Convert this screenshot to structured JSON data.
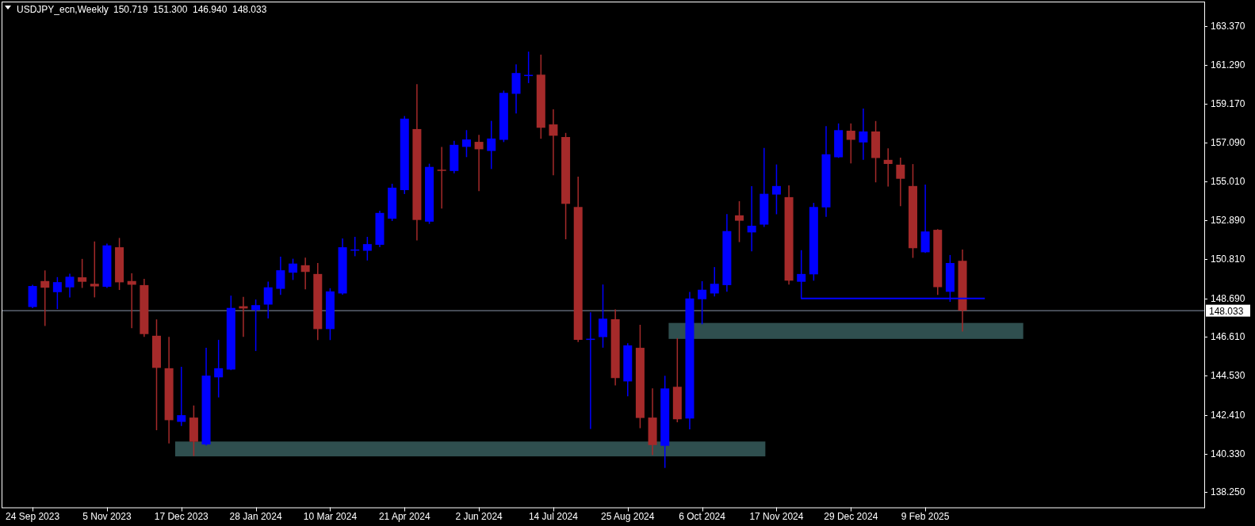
{
  "header": {
    "values": [
      "150.719",
      "151.300",
      "146.940",
      "148.033"
    ]
  },
  "chart_data": {
    "type": "candlestick",
    "title": "USDJPY_ecn,Weekly",
    "categories": [
      null,
      null,
      "24 Sep 2023",
      null,
      null,
      null,
      null,
      null,
      "5 Nov 2023",
      null,
      null,
      null,
      null,
      null,
      "17 Dec 2023",
      null,
      null,
      null,
      null,
      null,
      "28 Jan 2024",
      null,
      null,
      null,
      null,
      null,
      "10 Mar 2024",
      null,
      null,
      null,
      null,
      null,
      "21 Apr 2024",
      null,
      null,
      null,
      null,
      null,
      "2 Jun 2024",
      null,
      null,
      null,
      null,
      null,
      "14 Jul 2024",
      null,
      null,
      null,
      null,
      null,
      "25 Aug 2024",
      null,
      null,
      null,
      null,
      null,
      "6 Oct 2024",
      null,
      null,
      null,
      null,
      null,
      "17 Nov 2024",
      null,
      null,
      null,
      null,
      null,
      "29 Dec 2024",
      null,
      null,
      null,
      null,
      null,
      "9 Feb 2025",
      null,
      null,
      null,
      null,
      null,
      null,
      null,
      null,
      null,
      null,
      null,
      null,
      null,
      null,
      null,
      null,
      null,
      null,
      null,
      null,
      null,
      null
    ],
    "ohlc": [
      null,
      null,
      [
        148.23,
        149.4,
        148.2,
        149.36
      ],
      [
        149.63,
        150.17,
        147.24,
        149.27
      ],
      [
        149.03,
        149.81,
        148.15,
        149.57
      ],
      [
        149.29,
        149.99,
        148.78,
        149.86
      ],
      [
        149.83,
        150.79,
        149.29,
        149.59
      ],
      [
        149.48,
        151.73,
        148.78,
        149.34
      ],
      [
        149.32,
        151.62,
        149.29,
        151.55
      ],
      [
        151.45,
        151.92,
        149.18,
        149.56
      ],
      [
        149.63,
        150.01,
        147.12,
        149.43
      ],
      [
        149.41,
        149.72,
        146.65,
        146.77
      ],
      [
        146.68,
        147.53,
        141.62,
        144.95
      ],
      [
        144.93,
        146.59,
        140.91,
        142.13
      ],
      [
        142.04,
        144.98,
        141.85,
        142.4
      ],
      [
        142.27,
        142.89,
        140.23,
        140.97
      ],
      [
        140.82,
        146.0,
        140.79,
        144.53
      ],
      [
        144.44,
        146.43,
        143.39,
        144.93
      ],
      [
        144.86,
        148.81,
        144.86,
        148.18
      ],
      [
        148.27,
        148.74,
        146.65,
        148.15
      ],
      [
        148.06,
        148.6,
        145.89,
        148.33
      ],
      [
        148.36,
        149.57,
        147.64,
        149.29
      ],
      [
        149.21,
        150.91,
        148.91,
        150.21
      ],
      [
        150.08,
        150.8,
        149.72,
        150.57
      ],
      [
        150.48,
        150.86,
        149.21,
        150.12
      ],
      [
        150.01,
        150.57,
        146.48,
        147.04
      ],
      [
        147.04,
        149.21,
        146.48,
        149.07
      ],
      [
        148.96,
        151.89,
        148.92,
        151.45
      ],
      [
        151.31,
        151.98,
        151.0,
        151.33
      ],
      [
        151.26,
        151.98,
        150.77,
        151.62
      ],
      [
        151.58,
        153.39,
        151.49,
        153.3
      ],
      [
        152.99,
        154.84,
        152.9,
        154.66
      ],
      [
        154.53,
        158.49,
        154.35,
        158.38
      ],
      [
        157.82,
        160.21,
        151.85,
        152.92
      ],
      [
        152.83,
        155.92,
        152.74,
        155.78
      ],
      [
        155.63,
        156.82,
        153.57,
        155.6
      ],
      [
        155.56,
        157.15,
        155.47,
        156.97
      ],
      [
        156.86,
        157.73,
        156.34,
        157.26
      ],
      [
        157.13,
        157.48,
        154.51,
        156.73
      ],
      [
        156.64,
        158.23,
        155.7,
        157.31
      ],
      [
        157.24,
        159.86,
        157.15,
        159.77
      ],
      [
        159.72,
        161.27,
        158.69,
        160.84
      ],
      [
        160.72,
        161.96,
        160.33,
        160.74
      ],
      [
        160.75,
        161.8,
        157.33,
        157.89
      ],
      [
        158.07,
        158.85,
        155.36,
        157.46
      ],
      [
        157.39,
        157.58,
        151.91,
        153.79
      ],
      [
        153.62,
        155.22,
        146.37,
        146.46
      ],
      [
        146.5,
        147.91,
        141.69,
        146.52
      ],
      [
        146.61,
        149.41,
        146.07,
        147.6
      ],
      [
        147.57,
        148.07,
        144.04,
        144.4
      ],
      [
        144.22,
        146.25,
        143.45,
        146.16
      ],
      [
        146.03,
        147.24,
        141.73,
        142.25
      ],
      [
        142.27,
        143.81,
        140.28,
        140.79
      ],
      [
        140.75,
        144.49,
        139.59,
        143.84
      ],
      [
        143.93,
        146.52,
        142.05,
        142.18
      ],
      [
        142.22,
        149.01,
        141.67,
        148.69
      ],
      [
        148.65,
        149.59,
        147.33,
        149.16
      ],
      [
        148.96,
        150.35,
        148.83,
        149.48
      ],
      [
        149.41,
        153.21,
        149.09,
        152.32
      ],
      [
        153.17,
        153.9,
        151.76,
        152.88
      ],
      [
        152.25,
        154.71,
        151.26,
        152.61
      ],
      [
        152.67,
        156.77,
        152.58,
        154.33
      ],
      [
        154.29,
        155.88,
        153.26,
        154.75
      ],
      [
        154.15,
        154.75,
        149.47,
        149.65
      ],
      [
        149.59,
        151.26,
        148.69,
        150.01
      ],
      [
        149.99,
        153.81,
        149.68,
        153.62
      ],
      [
        153.6,
        157.94,
        153.12,
        156.46
      ],
      [
        156.3,
        158.09,
        156.3,
        157.76
      ],
      [
        157.73,
        158.09,
        156.0,
        157.24
      ],
      [
        157.1,
        158.89,
        156.19,
        157.69
      ],
      [
        157.69,
        158.22,
        154.98,
        156.26
      ],
      [
        156.16,
        156.75,
        154.75,
        155.94
      ],
      [
        155.9,
        156.25,
        153.7,
        155.14
      ],
      [
        154.75,
        155.9,
        150.91,
        151.4
      ],
      [
        151.18,
        154.8,
        151.18,
        152.3
      ],
      [
        152.39,
        152.39,
        148.91,
        149.3
      ],
      [
        149.05,
        151.0,
        148.54,
        150.6
      ],
      [
        150.719,
        151.3,
        146.94,
        148.033
      ],
      null,
      null,
      null,
      null,
      null,
      null,
      null,
      null,
      null,
      null,
      null,
      null,
      null,
      null,
      null,
      null,
      null,
      null,
      null
    ],
    "ylim": [
      137.43,
      164.69
    ],
    "yticks": [
      {
        "value": 163.37,
        "label": "163.370"
      },
      {
        "value": 161.29,
        "label": "161.290"
      },
      {
        "value": 159.17,
        "label": "159.170"
      },
      {
        "value": 157.09,
        "label": "157.090"
      },
      {
        "value": 155.01,
        "label": "155.010"
      },
      {
        "value": 152.89,
        "label": "152.890"
      },
      {
        "value": 150.81,
        "label": "150.810"
      },
      {
        "value": 148.69,
        "label": "148.690"
      },
      {
        "value": 146.61,
        "label": "146.610"
      },
      {
        "value": 144.53,
        "label": "144.530"
      },
      {
        "value": 142.41,
        "label": "142.410"
      },
      {
        "value": 140.33,
        "label": "140.330"
      },
      {
        "value": 138.25,
        "label": "138.250"
      }
    ],
    "ref_lines": [
      {
        "axis": "y",
        "value": 148.033,
        "label": "148.033",
        "color": "#8a96a8"
      },
      {
        "axis": "y",
        "value": 148.69,
        "color": "#0000ff"
      }
    ]
  }
}
